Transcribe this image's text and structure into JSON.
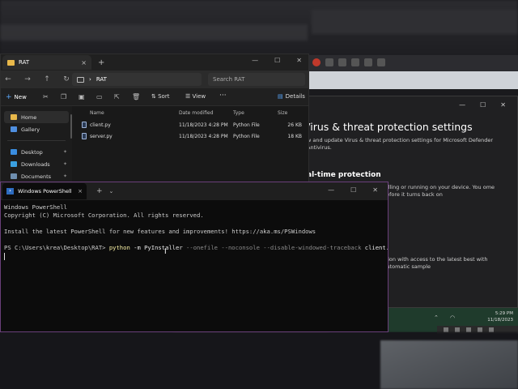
{
  "explorer": {
    "tab_title": "RAT",
    "tab_close": "×",
    "new_tab": "+",
    "window_controls": [
      "—",
      "☐",
      "✕"
    ],
    "nav": [
      "←",
      "→",
      "↑",
      "↻"
    ],
    "path": "RAT",
    "path_chevron": "›",
    "search_placeholder": "Search RAT",
    "toolbar": {
      "new_label": "New",
      "new_icon": "+",
      "sort_label": "⇅ Sort",
      "view_label": "☰ View",
      "more_label": "···",
      "details_label": "Details"
    },
    "sidebar": [
      {
        "label": "Home",
        "color": "#e8b84a",
        "pin": ""
      },
      {
        "label": "Gallery",
        "color": "#4f8fe0",
        "pin": ""
      },
      {
        "label": "Desktop",
        "color": "#3a8de0",
        "pin": "✦"
      },
      {
        "label": "Downloads",
        "color": "#3aa0e0",
        "pin": "✦"
      },
      {
        "label": "Documents",
        "color": "#6f8fb0",
        "pin": "✦"
      }
    ],
    "columns": [
      "Name",
      "Date modified",
      "Type",
      "Size"
    ],
    "files": [
      {
        "name": "client.py",
        "date": "11/18/2023 4:28 PM",
        "type": "Python File",
        "size": "26 KB"
      },
      {
        "name": "server.py",
        "date": "11/18/2023 4:28 PM",
        "type": "Python File",
        "size": "18 KB"
      }
    ]
  },
  "security": {
    "window_controls": [
      "—",
      "☐",
      "✕"
    ],
    "title": "Virus & threat protection settings",
    "description": "w and update Virus & threat protection settings for Microsoft Defender Antivirus.",
    "section_title": "al-time protection",
    "section_text": "talling or running on your device. You ome before it turns back on",
    "section2_title": "n",
    "section2_text": "ction with access to the latest best with Automatic sample"
  },
  "taskbar": {
    "time": "5:29 PM",
    "date": "11/18/2023"
  },
  "powershell": {
    "tab_title": "Windows PowerShell",
    "tab_close": "×",
    "new_tab": "+",
    "dropdown": "⌄",
    "window_controls": [
      "—",
      "☐",
      "✕"
    ],
    "lines": [
      "Windows PowerShell",
      "Copyright (C) Microsoft Corporation. All rights reserved.",
      "",
      "Install the latest PowerShell for new features and improvements! https://aka.ms/PSWindows",
      ""
    ],
    "prompt": "PS C:\\Users\\krea\\Desktop\\RAT> ",
    "command": "python",
    "args_yellow": " -m PyInstaller ",
    "args_gray": "--onefile --noconsole --disable-windowed-traceback",
    "args_white": " client.py"
  },
  "colors": {
    "ps_border": "#6a3f7a",
    "folder": "#e8b84a",
    "accent": "#5aa9ff"
  }
}
